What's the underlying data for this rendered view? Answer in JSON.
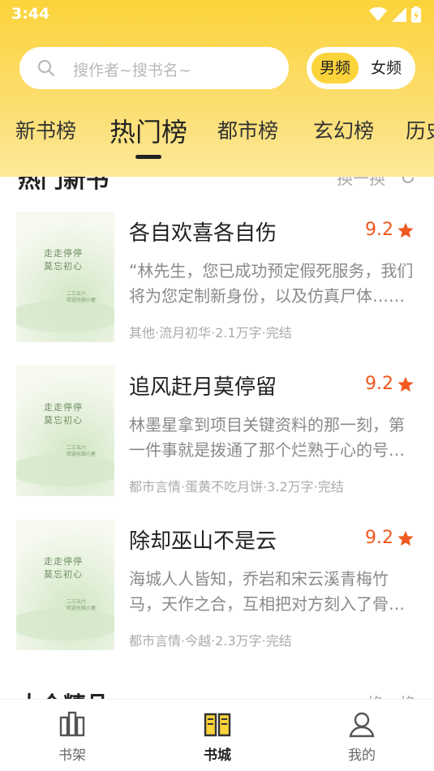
{
  "status_bar": {
    "time": "3:44"
  },
  "search": {
    "placeholder": "搜作者~搜书名~"
  },
  "gender": {
    "male": "男频",
    "female": "女频"
  },
  "tabs": [
    {
      "label": "新书榜"
    },
    {
      "label": "热门榜"
    },
    {
      "label": "都市榜"
    },
    {
      "label": "玄幻榜"
    },
    {
      "label": "历史榜"
    }
  ],
  "section_top": {
    "title": "热门新书",
    "refresh_label": "换一换"
  },
  "books": [
    {
      "title": "各自欢喜各自伤",
      "rating": "9.2",
      "desc": "“林先生，您已成功预定假死服务，我们将为您定制新身份，以及仿真尸体……",
      "meta": "其他·流月初华·2.1万字·完结",
      "cover_title": "走走停停\n莫忘初心",
      "cover_sub": "二三五六\n欢迎光临小屋"
    },
    {
      "title": "追风赶月莫停留",
      "rating": "9.2",
      "desc": "林墨星拿到项目关键资料的那一刻，第一件事就是拨通了那个烂熟于心的号码……",
      "meta": "都市言情·蛋黄不吃月饼·3.2万字·完结",
      "cover_title": "走走停停\n莫忘初心",
      "cover_sub": "二三五六\n欢迎光临小屋"
    },
    {
      "title": "除却巫山不是云",
      "rating": "9.2",
      "desc": "海城人人皆知，乔岩和宋云溪青梅竹马，天作之合，互相把对方刻入了骨血……",
      "meta": "都市言情·今越·2.3万字·完结",
      "cover_title": "走走停停\n莫忘初心",
      "cover_sub": "二三五六\n欢迎光临小屋"
    }
  ],
  "section_bottom": {
    "title": "大众精品",
    "refresh_label": "换一换"
  },
  "bottom_nav": [
    {
      "label": "书架",
      "icon": "bookshelf-icon"
    },
    {
      "label": "书城",
      "icon": "bookstore-icon"
    },
    {
      "label": "我的",
      "icon": "profile-icon"
    }
  ],
  "colors": {
    "accent": "#fbd33a",
    "rating": "#f0581f"
  }
}
